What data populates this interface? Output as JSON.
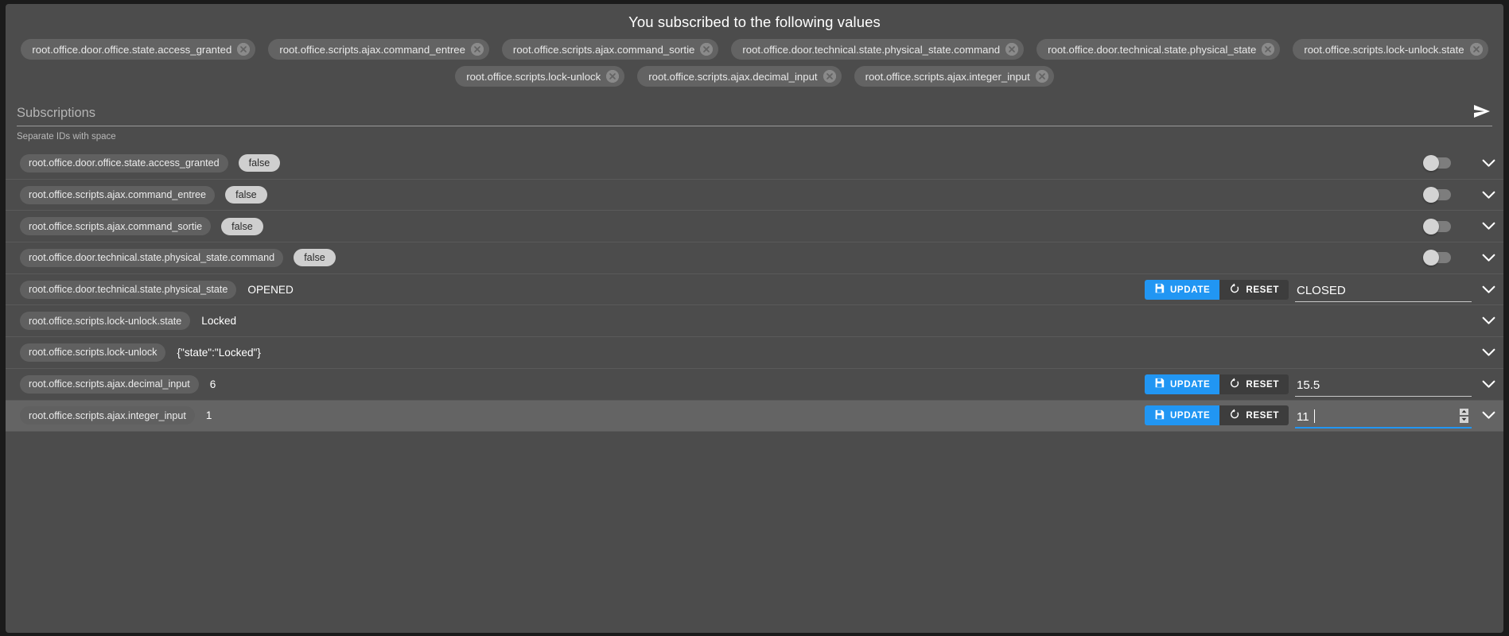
{
  "header": {
    "title": "You subscribed to the following values"
  },
  "chips": {
    "row1": [
      "root.office.door.office.state.access_granted",
      "root.office.scripts.ajax.command_entree",
      "root.office.scripts.ajax.command_sortie",
      "root.office.door.technical.state.physical_state.command",
      "root.office.door.technical.state.physical_state",
      "root.office.scripts.lock-unlock.state"
    ],
    "row2": [
      "root.office.scripts.lock-unlock",
      "root.office.scripts.ajax.decimal_input",
      "root.office.scripts.ajax.integer_input"
    ],
    "close_icon": "close-icon"
  },
  "subscription_field": {
    "label": "Subscriptions",
    "value": "",
    "placeholder": "Subscriptions",
    "hint": "Separate IDs with space",
    "send_icon": "send-icon"
  },
  "buttons": {
    "update_label": "UPDATE",
    "reset_label": "RESET",
    "update_icon": "save-icon",
    "reset_icon": "restore-icon"
  },
  "colors": {
    "accent": "#2196f3",
    "page_bg": "#4c4c4c",
    "row_highlight": "#646464",
    "chip_bg": "#636363",
    "value_chip_bg": "#cfcfcf"
  },
  "rows": [
    {
      "key": "root.office.door.office.state.access_granted",
      "value": "false",
      "value_kind": "chip",
      "control": "toggle",
      "toggle_on": false,
      "highlight": false
    },
    {
      "key": "root.office.scripts.ajax.command_entree",
      "value": "false",
      "value_kind": "chip",
      "control": "toggle",
      "toggle_on": false,
      "highlight": false
    },
    {
      "key": "root.office.scripts.ajax.command_sortie",
      "value": "false",
      "value_kind": "chip",
      "control": "toggle",
      "toggle_on": false,
      "highlight": false
    },
    {
      "key": "root.office.door.technical.state.physical_state.command",
      "value": "false",
      "value_kind": "chip",
      "control": "toggle",
      "toggle_on": false,
      "highlight": false
    },
    {
      "key": "root.office.door.technical.state.physical_state",
      "value": "OPENED",
      "value_kind": "plain",
      "control": "editor",
      "editor_value": "CLOSED",
      "editor_focused": false,
      "editor_spinner": false,
      "highlight": false
    },
    {
      "key": "root.office.scripts.lock-unlock.state",
      "value": "Locked",
      "value_kind": "plain",
      "control": "none",
      "highlight": false
    },
    {
      "key": "root.office.scripts.lock-unlock",
      "value": "{\"state\":\"Locked\"}",
      "value_kind": "plain",
      "control": "none",
      "highlight": false
    },
    {
      "key": "root.office.scripts.ajax.decimal_input",
      "value": "6",
      "value_kind": "plain",
      "control": "editor",
      "editor_value": "15.5",
      "editor_focused": false,
      "editor_spinner": false,
      "highlight": false
    },
    {
      "key": "root.office.scripts.ajax.integer_input",
      "value": "1",
      "value_kind": "plain",
      "control": "editor",
      "editor_value": "11",
      "editor_focused": true,
      "editor_spinner": true,
      "highlight": true
    }
  ]
}
